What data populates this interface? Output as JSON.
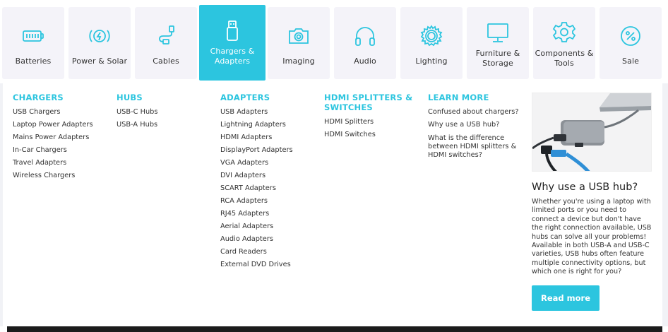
{
  "categories": [
    {
      "label": "Batteries",
      "icon": "battery-icon"
    },
    {
      "label": "Power & Solar",
      "icon": "power-icon"
    },
    {
      "label": "Cables",
      "icon": "cable-icon"
    },
    {
      "label": "Chargers &\nAdapters",
      "icon": "usb-icon",
      "active": true
    },
    {
      "label": "Imaging",
      "icon": "camera-icon"
    },
    {
      "label": "Audio",
      "icon": "headphones-icon"
    },
    {
      "label": "Lighting",
      "icon": "light-icon"
    },
    {
      "label": "Furniture &\nStorage",
      "icon": "monitor-icon"
    },
    {
      "label": "Components &\nTools",
      "icon": "gear-icon"
    },
    {
      "label": "Sale",
      "icon": "sale-icon"
    }
  ],
  "menu": {
    "chargers": {
      "heading": "CHARGERS",
      "items": [
        "USB Chargers",
        "Laptop Power Adapters",
        "Mains Power Adapters",
        "In-Car Chargers",
        "Travel Adapters",
        "Wireless Chargers"
      ]
    },
    "hubs": {
      "heading": "HUBS",
      "items": [
        "USB-C Hubs",
        "USB-A Hubs"
      ]
    },
    "adapters": {
      "heading": "ADAPTERS",
      "items": [
        "USB Adapters",
        "Lightning Adapters",
        "HDMI Adapters",
        "DisplayPort Adapters",
        "VGA Adapters",
        "DVI Adapters",
        "SCART Adapters",
        "RCA Adapters",
        "RJ45 Adapters",
        "Aerial Adapters",
        "Audio Adapters",
        "Card Readers",
        "External DVD Drives"
      ]
    },
    "hdmi": {
      "heading": "HDMI SPLITTERS & SWITCHES",
      "items": [
        "HDMI Splitters",
        "HDMI Switches"
      ]
    },
    "learn": {
      "heading": "LEARN MORE",
      "items": [
        "Confused about chargers?",
        "Why use a USB hub?",
        "What is the difference between HDMI splitters & HDMI switches?"
      ]
    }
  },
  "promo": {
    "title": "Why use a USB hub?",
    "text": "Whether you're using a laptop with limited ports or you need to connect a device but don't have the right connection available, USB hubs can solve all your problems! Available in both USB-A and USB-C varieties, USB hubs often feature multiple connectivity options, but which one is right for you?",
    "button": "Read more"
  },
  "colors": {
    "accent": "#2cc5df",
    "tile_bg": "#f4f3f9"
  }
}
